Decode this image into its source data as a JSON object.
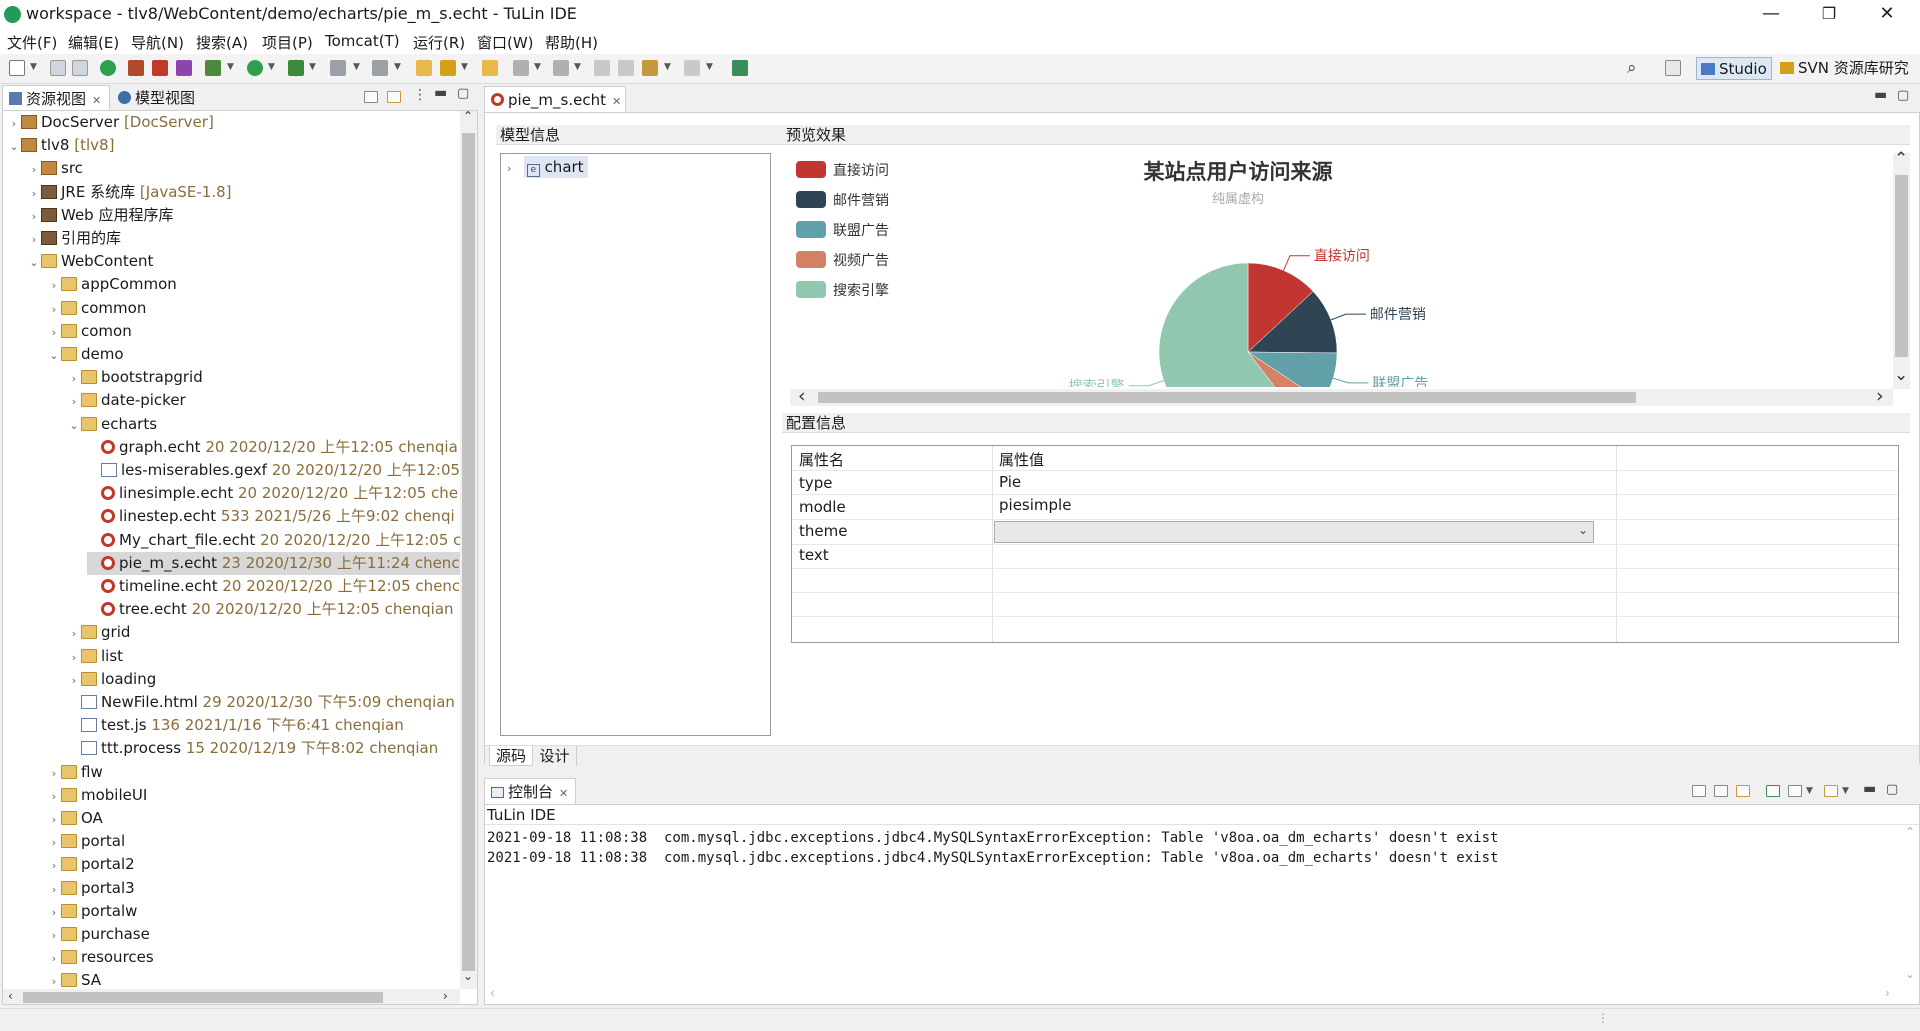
{
  "window": {
    "title": "workspace - tlv8/WebContent/demo/echarts/pie_m_s.echt - TuLin IDE",
    "minimize": "—",
    "maximize": "❐",
    "close": "✕"
  },
  "menu": [
    "文件(F)",
    "编辑(E)",
    "导航(N)",
    "搜索(A)",
    "项目(P)",
    "Tomcat(T)",
    "运行(R)",
    "窗口(W)",
    "帮助(H)"
  ],
  "perspectives": {
    "studio": "Studio",
    "svn": "SVN 资源库研究"
  },
  "left_tabs": {
    "resources": "资源视图",
    "model": "模型视图"
  },
  "tree": [
    {
      "indent": 0,
      "arrow": "›",
      "icon": "pkg",
      "label": "DocServer",
      "deco": " [DocServer]"
    },
    {
      "indent": 0,
      "arrow": "⌄",
      "icon": "pkg",
      "label": "tlv8",
      "deco": " [tlv8]"
    },
    {
      "indent": 1,
      "arrow": "›",
      "icon": "pkg",
      "label": "src",
      "deco": ""
    },
    {
      "indent": 1,
      "arrow": "›",
      "icon": "lib",
      "label": "JRE 系统库",
      "deco": " [JavaSE-1.8]"
    },
    {
      "indent": 1,
      "arrow": "›",
      "icon": "lib",
      "label": "Web 应用程序库",
      "deco": ""
    },
    {
      "indent": 1,
      "arrow": "›",
      "icon": "lib",
      "label": "引用的库",
      "deco": ""
    },
    {
      "indent": 1,
      "arrow": "⌄",
      "icon": "folder",
      "label": "WebContent",
      "deco": ""
    },
    {
      "indent": 2,
      "arrow": "›",
      "icon": "folder",
      "label": "appCommon",
      "deco": ""
    },
    {
      "indent": 2,
      "arrow": "›",
      "icon": "folder",
      "label": "common",
      "deco": ""
    },
    {
      "indent": 2,
      "arrow": "›",
      "icon": "folder",
      "label": "comon",
      "deco": ""
    },
    {
      "indent": 2,
      "arrow": "⌄",
      "icon": "folder",
      "label": "demo",
      "deco": ""
    },
    {
      "indent": 3,
      "arrow": "›",
      "icon": "folder",
      "label": "bootstrapgrid",
      "deco": ""
    },
    {
      "indent": 3,
      "arrow": "›",
      "icon": "folder",
      "label": "date-picker",
      "deco": ""
    },
    {
      "indent": 3,
      "arrow": "⌄",
      "icon": "folder",
      "label": "echarts",
      "deco": ""
    },
    {
      "indent": 4,
      "arrow": "",
      "icon": "echt",
      "label": "graph.echt",
      "deco": " 20  2020/12/20 上午12:05  chenqia"
    },
    {
      "indent": 4,
      "arrow": "",
      "icon": "file",
      "label": "les-miserables.gexf",
      "deco": " 20  2020/12/20 上午12:05"
    },
    {
      "indent": 4,
      "arrow": "",
      "icon": "echt",
      "label": "linesimple.echt",
      "deco": " 20  2020/12/20 上午12:05  che"
    },
    {
      "indent": 4,
      "arrow": "",
      "icon": "echt",
      "label": "linestep.echt",
      "deco": " 533  2021/5/26 上午9:02  chenqi"
    },
    {
      "indent": 4,
      "arrow": "",
      "icon": "echt",
      "label": "My_chart_file.echt",
      "deco": " 20  2020/12/20 上午12:05  c"
    },
    {
      "indent": 4,
      "arrow": "",
      "icon": "echt",
      "label": "pie_m_s.echt",
      "deco": " 23  2020/12/30 上午11:24  chenc",
      "selected": true
    },
    {
      "indent": 4,
      "arrow": "",
      "icon": "echt",
      "label": "timeline.echt",
      "deco": " 20  2020/12/20 上午12:05  chenc"
    },
    {
      "indent": 4,
      "arrow": "",
      "icon": "echt",
      "label": "tree.echt",
      "deco": " 20  2020/12/20 上午12:05  chenqian"
    },
    {
      "indent": 3,
      "arrow": "›",
      "icon": "folder",
      "label": "grid",
      "deco": ""
    },
    {
      "indent": 3,
      "arrow": "›",
      "icon": "folder",
      "label": "list",
      "deco": ""
    },
    {
      "indent": 3,
      "arrow": "›",
      "icon": "folder",
      "label": "loading",
      "deco": ""
    },
    {
      "indent": 3,
      "arrow": "",
      "icon": "file",
      "label": "NewFile.html",
      "deco": " 29  2020/12/30 下午5:09  chenqian"
    },
    {
      "indent": 3,
      "arrow": "",
      "icon": "file",
      "label": "test.js",
      "deco": " 136  2021/1/16 下午6:41  chenqian"
    },
    {
      "indent": 3,
      "arrow": "",
      "icon": "file",
      "label": "ttt.process",
      "deco": " 15  2020/12/19 下午8:02  chenqian"
    },
    {
      "indent": 2,
      "arrow": "›",
      "icon": "folder",
      "label": "flw",
      "deco": ""
    },
    {
      "indent": 2,
      "arrow": "›",
      "icon": "folder",
      "label": "mobileUI",
      "deco": ""
    },
    {
      "indent": 2,
      "arrow": "›",
      "icon": "folder",
      "label": "OA",
      "deco": ""
    },
    {
      "indent": 2,
      "arrow": "›",
      "icon": "folder",
      "label": "portal",
      "deco": ""
    },
    {
      "indent": 2,
      "arrow": "›",
      "icon": "folder",
      "label": "portal2",
      "deco": ""
    },
    {
      "indent": 2,
      "arrow": "›",
      "icon": "folder",
      "label": "portal3",
      "deco": ""
    },
    {
      "indent": 2,
      "arrow": "›",
      "icon": "folder",
      "label": "portalw",
      "deco": ""
    },
    {
      "indent": 2,
      "arrow": "›",
      "icon": "folder",
      "label": "purchase",
      "deco": ""
    },
    {
      "indent": 2,
      "arrow": "›",
      "icon": "folder",
      "label": "resources",
      "deco": ""
    },
    {
      "indent": 2,
      "arrow": "›",
      "icon": "folder",
      "label": "SA",
      "deco": ""
    }
  ],
  "editor": {
    "tab": "pie_m_s.echt",
    "model_header": "模型信息",
    "model_node": "chart",
    "preview_header": "预览效果",
    "config_header": "配置信息",
    "bottom_tabs": {
      "source": "源码",
      "design": "设计"
    },
    "prop_headers": {
      "name": "属性名",
      "value": "属性值"
    },
    "props": [
      {
        "name": "type",
        "value": "Pie"
      },
      {
        "name": "modle",
        "value": "piesimple"
      },
      {
        "name": "theme",
        "value": ""
      },
      {
        "name": "text",
        "value": ""
      }
    ]
  },
  "chart_data": {
    "type": "pie",
    "title": "某站点用户访问来源",
    "subtitle": "纯属虚构",
    "categories": [
      "直接访问",
      "邮件营销",
      "联盟广告",
      "视频广告",
      "搜索引擎"
    ],
    "values": [
      335,
      310,
      234,
      135,
      1548
    ],
    "colors": [
      "#c23531",
      "#2f4554",
      "#61a0a8",
      "#d48265",
      "#91c7ae"
    ],
    "legend_position": "top-left"
  },
  "console": {
    "tab": "控制台",
    "label": "TuLin IDE",
    "lines": [
      "2021-09-18 11:08:38  com.mysql.jdbc.exceptions.jdbc4.MySQLSyntaxErrorException: Table 'v8oa.oa_dm_echarts' doesn't exist",
      "2021-09-18 11:08:38  com.mysql.jdbc.exceptions.jdbc4.MySQLSyntaxErrorException: Table 'v8oa.oa_dm_echarts' doesn't exist"
    ]
  }
}
